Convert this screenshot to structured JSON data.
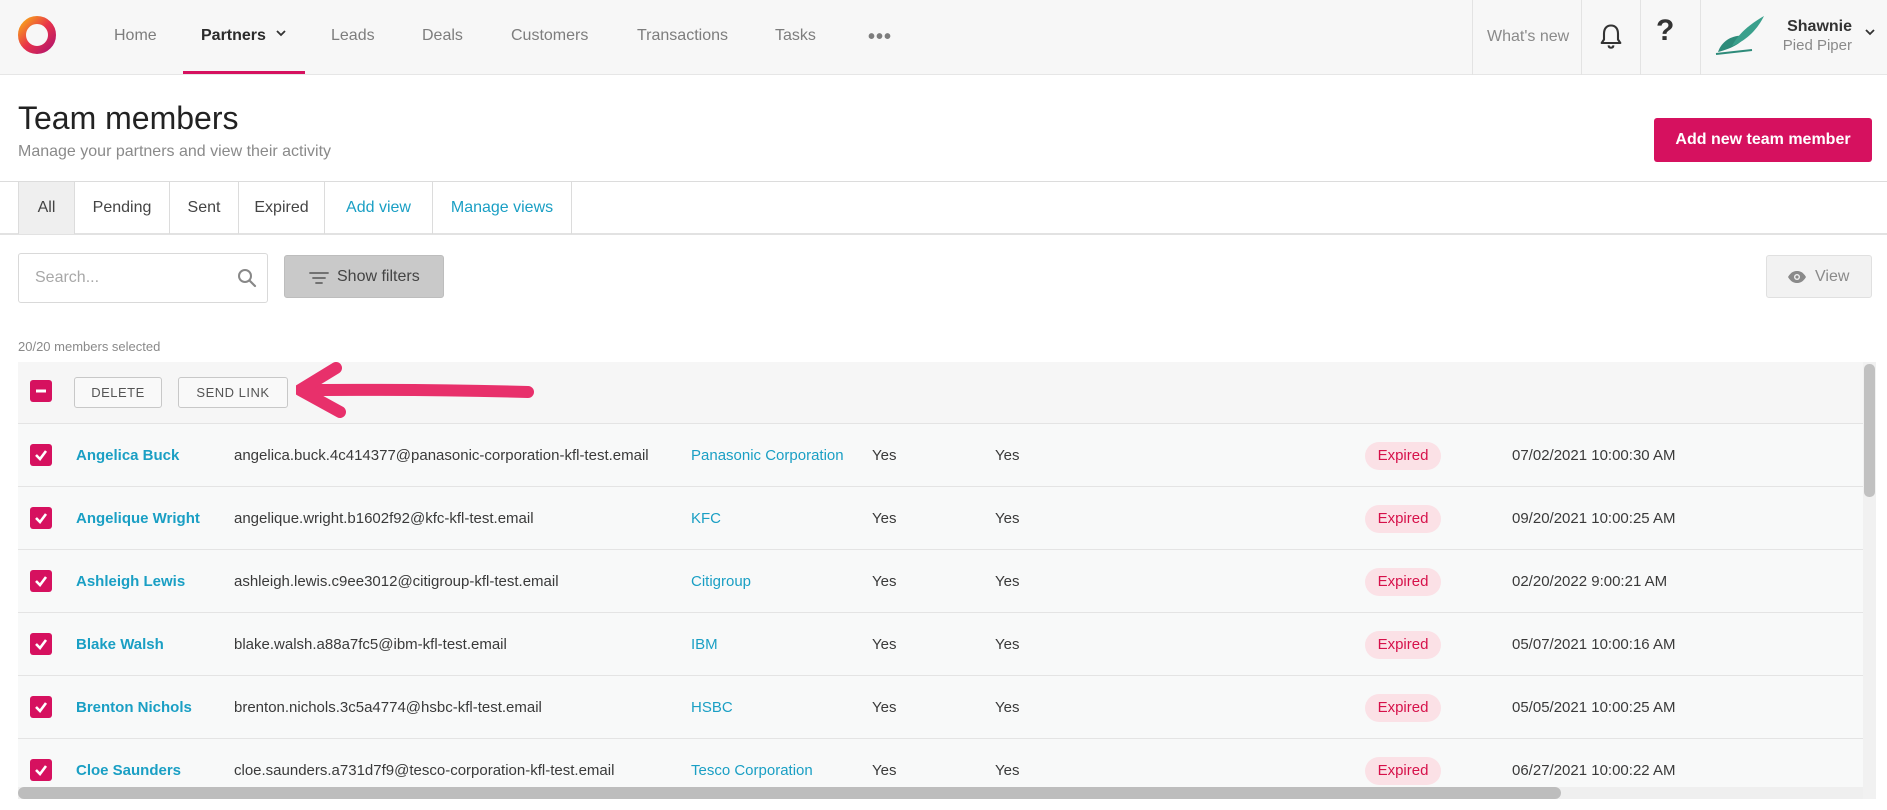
{
  "nav": {
    "items": [
      {
        "label": "Home"
      },
      {
        "label": "Partners"
      },
      {
        "label": "Leads"
      },
      {
        "label": "Deals"
      },
      {
        "label": "Customers"
      },
      {
        "label": "Transactions"
      },
      {
        "label": "Tasks"
      }
    ],
    "more_label": "•••",
    "whats_new": "What's new",
    "help": "?",
    "user": {
      "name": "Shawnie",
      "org": "Pied Piper"
    }
  },
  "header": {
    "title": "Team members",
    "subtitle": "Manage your partners and view their activity",
    "add_button": "Add new team member"
  },
  "tabs": [
    {
      "label": "All"
    },
    {
      "label": "Pending"
    },
    {
      "label": "Sent"
    },
    {
      "label": "Expired"
    },
    {
      "label": "Add view"
    },
    {
      "label": "Manage views"
    }
  ],
  "toolbar": {
    "search_placeholder": "Search...",
    "filters_label": "Show filters",
    "view_label": "View"
  },
  "selection": {
    "summary": "20/20 members selected",
    "delete_label": "DELETE",
    "send_link_label": "SEND LINK"
  },
  "rows": [
    {
      "name": "Angelica Buck",
      "email": "angelica.buck.4c414377@panasonic-corporation-kfl-test.email",
      "company": "Panasonic Corporation",
      "col1": "Yes",
      "col2": "Yes",
      "status": "Expired",
      "date": "07/02/2021 10:00:30 AM"
    },
    {
      "name": "Angelique Wright",
      "email": "angelique.wright.b1602f92@kfc-kfl-test.email",
      "company": "KFC",
      "col1": "Yes",
      "col2": "Yes",
      "status": "Expired",
      "date": "09/20/2021 10:00:25 AM"
    },
    {
      "name": "Ashleigh Lewis",
      "email": "ashleigh.lewis.c9ee3012@citigroup-kfl-test.email",
      "company": "Citigroup",
      "col1": "Yes",
      "col2": "Yes",
      "status": "Expired",
      "date": "02/20/2022 9:00:21 AM"
    },
    {
      "name": "Blake Walsh",
      "email": "blake.walsh.a88a7fc5@ibm-kfl-test.email",
      "company": "IBM",
      "col1": "Yes",
      "col2": "Yes",
      "status": "Expired",
      "date": "05/07/2021 10:00:16 AM"
    },
    {
      "name": "Brenton Nichols",
      "email": "brenton.nichols.3c5a4774@hsbc-kfl-test.email",
      "company": "HSBC",
      "col1": "Yes",
      "col2": "Yes",
      "status": "Expired",
      "date": "05/05/2021 10:00:25 AM"
    },
    {
      "name": "Cloe Saunders",
      "email": "cloe.saunders.a731d7f9@tesco-corporation-kfl-test.email",
      "company": "Tesco Corporation",
      "col1": "Yes",
      "col2": "Yes",
      "status": "Expired",
      "date": "06/27/2021 10:00:22 AM"
    }
  ],
  "colors": {
    "accent": "#d6115f",
    "link": "#1a9fc4",
    "badge_bg": "#fbe1e6",
    "badge_text": "#d6114a"
  }
}
